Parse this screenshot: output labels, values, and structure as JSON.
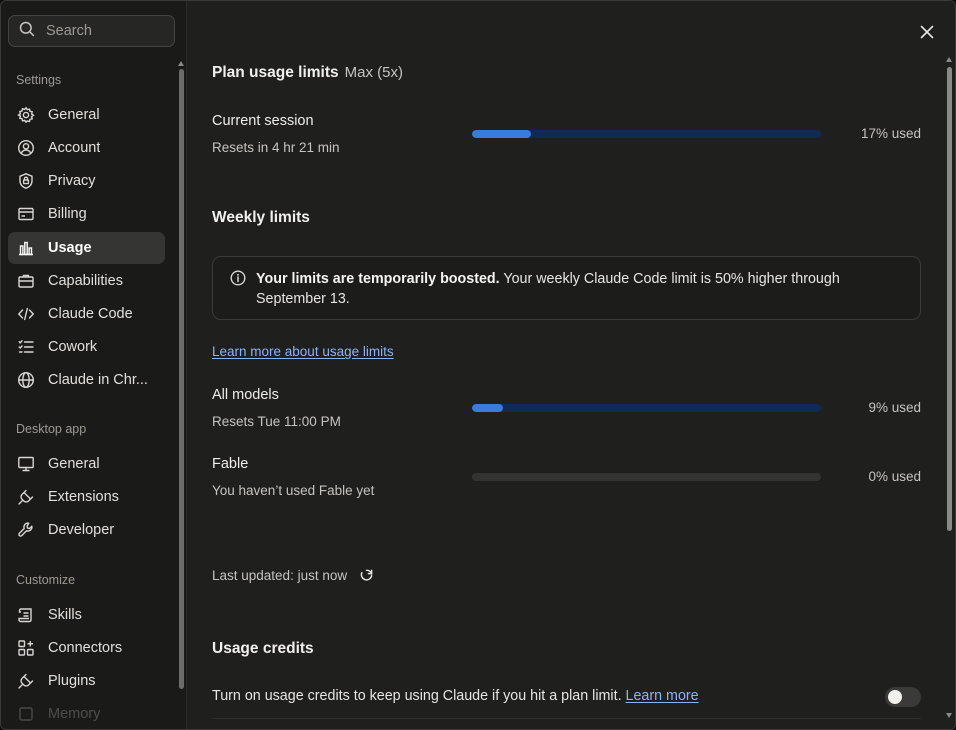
{
  "search": {
    "placeholder": "Search"
  },
  "sidebar": {
    "settings_label": "Settings",
    "settings_items": [
      {
        "label": "General",
        "icon": "gear-icon"
      },
      {
        "label": "Account",
        "icon": "account-icon"
      },
      {
        "label": "Privacy",
        "icon": "shield-icon"
      },
      {
        "label": "Billing",
        "icon": "card-icon"
      },
      {
        "label": "Usage",
        "icon": "bar-chart-icon",
        "active": true
      },
      {
        "label": "Capabilities",
        "icon": "briefcase-icon"
      },
      {
        "label": "Claude Code",
        "icon": "code-icon"
      },
      {
        "label": "Cowork",
        "icon": "checklist-icon"
      },
      {
        "label": "Claude in Chr...",
        "icon": "globe-icon"
      }
    ],
    "desktop_label": "Desktop app",
    "desktop_items": [
      {
        "label": "General",
        "icon": "monitor-icon"
      },
      {
        "label": "Extensions",
        "icon": "plug-icon"
      },
      {
        "label": "Developer",
        "icon": "wrench-icon"
      }
    ],
    "customize_label": "Customize",
    "customize_items": [
      {
        "label": "Skills",
        "icon": "scroll-icon"
      },
      {
        "label": "Connectors",
        "icon": "grid-plus-icon"
      },
      {
        "label": "Plugins",
        "icon": "plug-icon"
      },
      {
        "label": "Memory",
        "icon": "memory-icon"
      }
    ]
  },
  "main": {
    "title": "Plan usage limits",
    "plan": "Max (5x)",
    "current_session": {
      "title": "Current session",
      "resets": "Resets in 4 hr 21 min",
      "used_label": "17% used",
      "used_fraction": 0.17
    },
    "weekly_title": "Weekly limits",
    "notice": {
      "bold": "Your limits are temporarily boosted.",
      "text": " Your weekly Claude Code limit is 50% higher through September 13."
    },
    "learn_more": "Learn more about usage limits",
    "all_models": {
      "title": "All models",
      "resets": "Resets Tue 11:00 PM",
      "used_label": "9% used",
      "used_fraction": 0.09
    },
    "fable": {
      "title": "Fable",
      "resets": "You haven’t used Fable yet",
      "used_label": "0% used",
      "used_fraction": 0
    },
    "last_updated": "Last updated: just now",
    "credits_title": "Usage credits",
    "credits_text": "Turn on usage credits to keep using Claude if you hit a plan limit. ",
    "credits_link": "Learn more",
    "credits_enabled": false
  },
  "colors": {
    "accent": "#3a7bdc",
    "track": "#0f2a55",
    "link": "#8ab4f8"
  }
}
